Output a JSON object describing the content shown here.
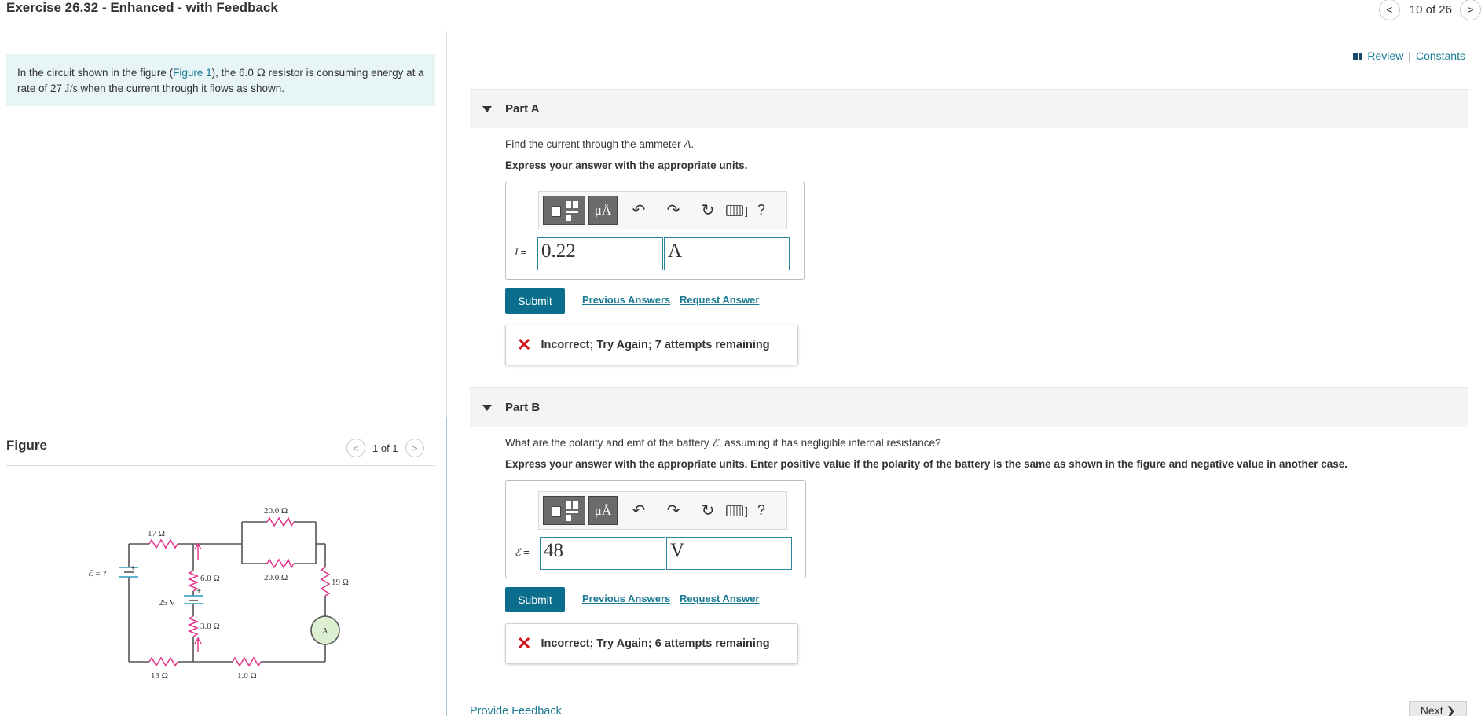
{
  "header": {
    "title": "Exercise 26.32 - Enhanced - with Feedback",
    "pager": {
      "prev_icon": "<",
      "count": "10 of 26",
      "next_icon": ">"
    }
  },
  "intro": {
    "part1": "In the circuit shown in the figure (",
    "figure_link": "Figure 1",
    "part2": "), the 6.0 ",
    "ohm": "Ω",
    "part3": " resistor is consuming energy at a rate of 27 ",
    "unit": "J/s",
    "part4": " when the current through it flows as shown."
  },
  "figure": {
    "label": "Figure",
    "pager": {
      "prev_icon": "<",
      "count": "1 of 1",
      "next_icon": ">"
    },
    "circuit": {
      "emf_label": "ℰ = ?",
      "r17": "17 Ω",
      "r6": "6.0 Ω",
      "r25v": "25 V",
      "r3": "3.0 Ω",
      "r20top": "20.0 Ω",
      "r20bot": "20.0 Ω",
      "r19": "19 Ω",
      "ammeter": "A",
      "r13": "13 Ω",
      "r1": "1.0 Ω",
      "plus": "+"
    }
  },
  "review": {
    "review": "Review",
    "sep": "|",
    "constants": "Constants"
  },
  "partA": {
    "label": "Part A",
    "question_pre": "Find the current through the ammeter ",
    "question_var": "A",
    "question_post": ".",
    "instruction": "Express your answer with the appropriate units.",
    "var": "I",
    "eq": "=",
    "value": "0.22",
    "unit": "A",
    "submit": "Submit",
    "prev_answers": "Previous Answers",
    "request_answer": "Request Answer",
    "feedback": "Incorrect; Try Again; 7 attempts remaining"
  },
  "partB": {
    "label": "Part B",
    "question_pre": "What are the polarity and emf of the battery ",
    "question_var": "ℰ",
    "question_post": ", assuming it has negligible internal resistance?",
    "instruction": "Express your answer with the appropriate units. Enter positive value if the polarity of the battery is the same as shown in the figure and negative value in another case.",
    "var": "ℰ",
    "eq": "=",
    "value": "48",
    "unit": "V",
    "submit": "Submit",
    "prev_answers": "Previous Answers",
    "request_answer": "Request Answer",
    "feedback": "Incorrect; Try Again; 6 attempts remaining"
  },
  "toolbar": {
    "unit_symbol": "μÅ",
    "help": "?",
    "kbd_bracket": "]"
  },
  "footer": {
    "provide_feedback": "Provide Feedback",
    "next": "Next ❯"
  },
  "colors": {
    "accent": "#0a6e8c",
    "link": "#1a7a93",
    "intro_bg": "#e8f5f6",
    "error": "#d4141b",
    "resistor": "#e0338a"
  }
}
